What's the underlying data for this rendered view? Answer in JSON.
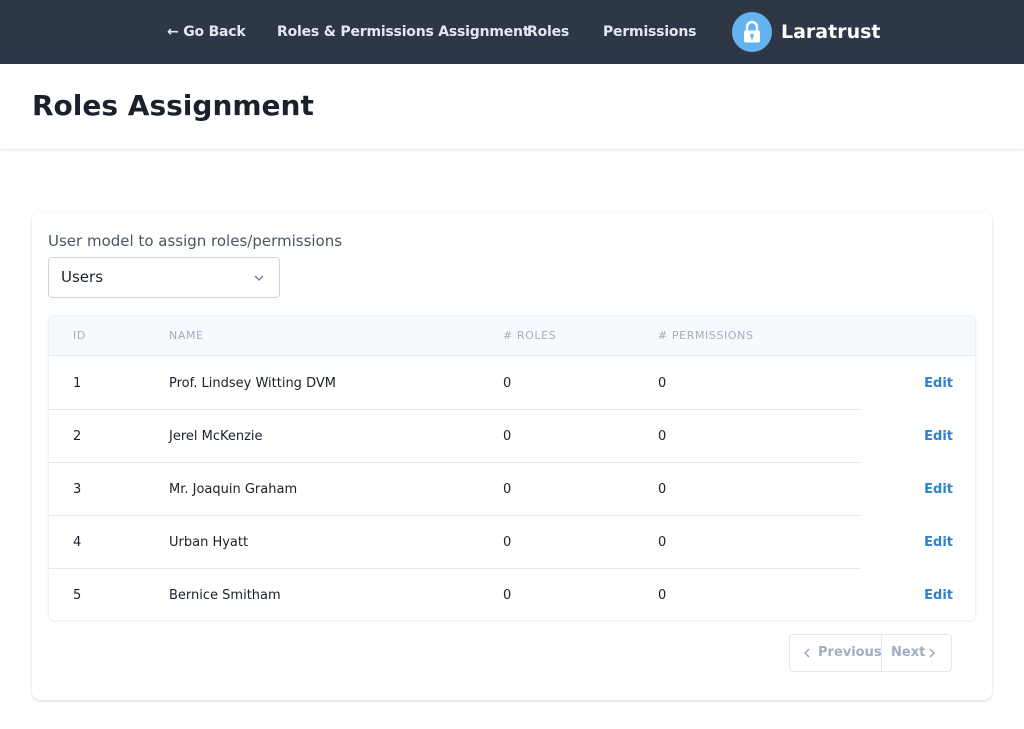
{
  "nav": {
    "go_back": "← Go Back",
    "roles_permissions_assignment": "Roles & Permissions Assignment",
    "roles": "Roles",
    "permissions": "Permissions",
    "brand_name": "Laratrust",
    "brand_icon": "lock-icon"
  },
  "header": {
    "title": "Roles Assignment"
  },
  "model_selector": {
    "label": "User model to assign roles/permissions",
    "selected": "Users",
    "icon": "chevron-down-icon"
  },
  "table": {
    "columns": [
      "ID",
      "NAME",
      "# ROLES",
      "# PERMISSIONS"
    ],
    "rows": [
      {
        "id": "1",
        "name": "Prof. Lindsey Witting DVM",
        "roles": "0",
        "permissions": "0",
        "action": "Edit"
      },
      {
        "id": "2",
        "name": "Jerel McKenzie",
        "roles": "0",
        "permissions": "0",
        "action": "Edit"
      },
      {
        "id": "3",
        "name": "Mr. Joaquin Graham",
        "roles": "0",
        "permissions": "0",
        "action": "Edit"
      },
      {
        "id": "4",
        "name": "Urban Hyatt",
        "roles": "0",
        "permissions": "0",
        "action": "Edit"
      },
      {
        "id": "5",
        "name": "Bernice Smitham",
        "roles": "0",
        "permissions": "0",
        "action": "Edit"
      }
    ]
  },
  "pagination": {
    "previous": "Previous",
    "next": "Next"
  },
  "colors": {
    "nav_bg": "#2d3748",
    "brand_logo": "#63b3ed",
    "link": "#3182ce",
    "muted": "#a0aec0"
  }
}
